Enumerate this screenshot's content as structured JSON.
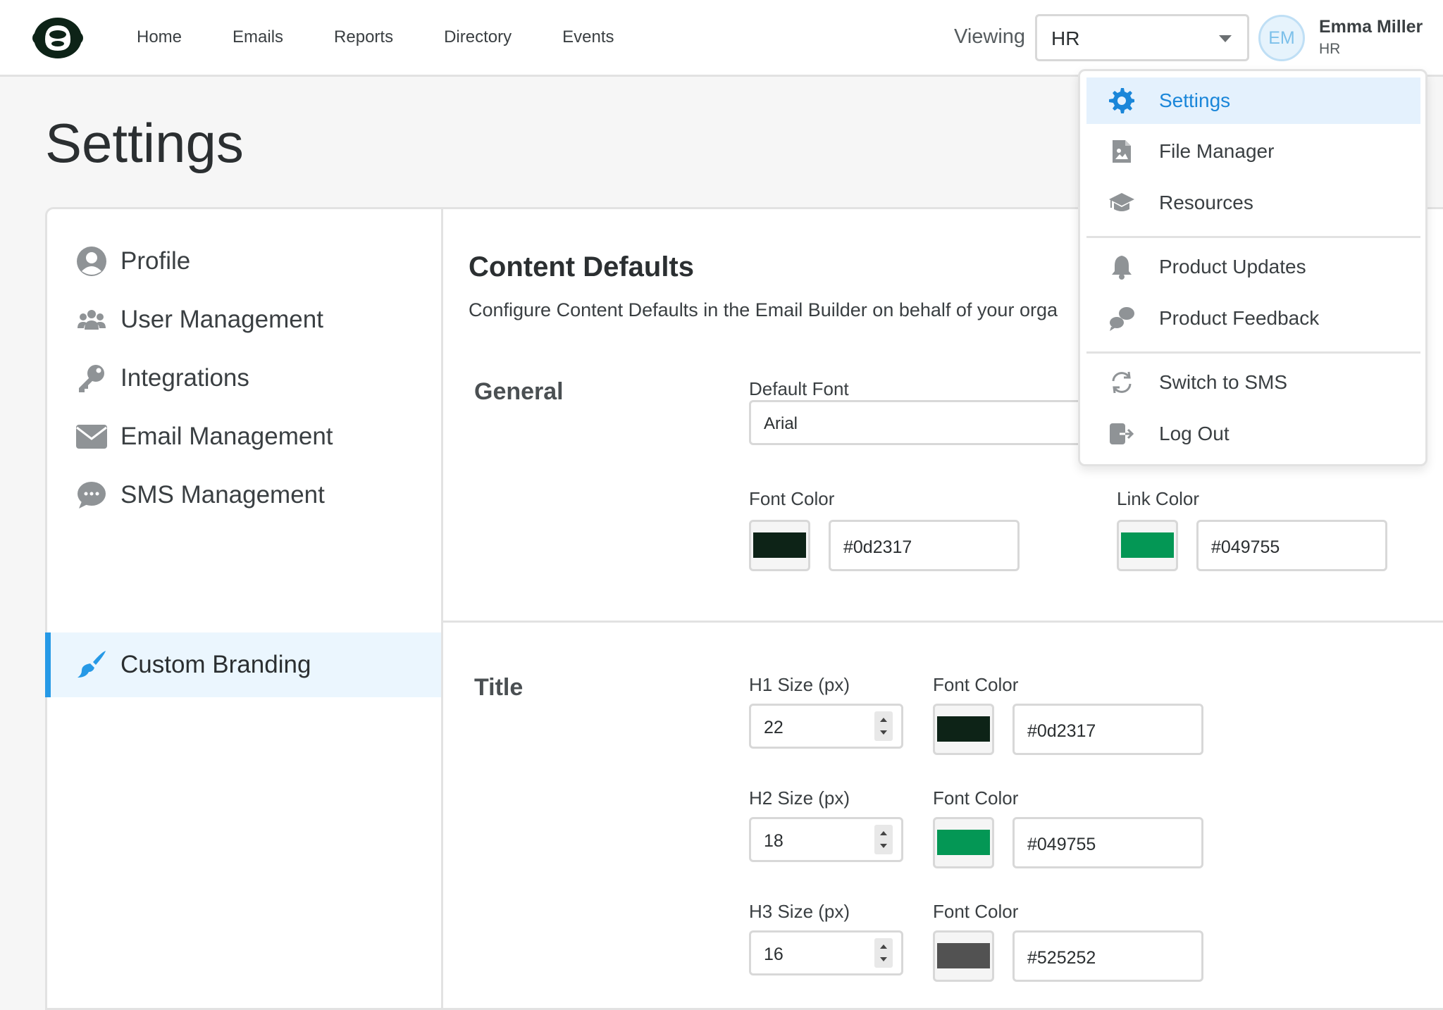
{
  "header": {
    "nav": [
      "Home",
      "Emails",
      "Reports",
      "Directory",
      "Events"
    ],
    "viewing_label": "Viewing",
    "viewing_value": "HR",
    "avatar_initials": "EM",
    "user_name": "Emma Miller",
    "user_org": "HR"
  },
  "page": {
    "title": "Settings"
  },
  "sidebar": {
    "items": [
      {
        "label": "Profile",
        "icon": "user-circle-icon"
      },
      {
        "label": "User Management",
        "icon": "users-icon"
      },
      {
        "label": "Integrations",
        "icon": "key-icon"
      },
      {
        "label": "Email Management",
        "icon": "envelope-icon"
      },
      {
        "label": "SMS Management",
        "icon": "chat-bubble-icon"
      },
      {
        "label": "Custom Branding",
        "icon": "paintbrush-icon",
        "active": true
      }
    ]
  },
  "content": {
    "title": "Content Defaults",
    "description": "Configure Content Defaults in the Email Builder on behalf of your orga",
    "general": {
      "title": "General",
      "default_font_label": "Default Font",
      "default_font_value": "Arial",
      "font_color_label": "Font Color",
      "font_color_value": "#0d2317",
      "link_color_label": "Link Color",
      "link_color_value": "#049755"
    },
    "title_section": {
      "title": "Title",
      "rows": [
        {
          "size_label": "H1 Size (px)",
          "size_value": "22",
          "color_label": "Font Color",
          "color_value": "#0d2317"
        },
        {
          "size_label": "H2 Size (px)",
          "size_value": "18",
          "color_label": "Font Color",
          "color_value": "#049755"
        },
        {
          "size_label": "H3 Size (px)",
          "size_value": "16",
          "color_label": "Font Color",
          "color_value": "#525252"
        }
      ]
    }
  },
  "menu": {
    "items": [
      {
        "label": "Settings",
        "icon": "gear-icon",
        "active": true
      },
      {
        "label": "File Manager",
        "icon": "file-image-icon"
      },
      {
        "label": "Resources",
        "icon": "graduation-cap-icon"
      },
      {
        "label": "Product Updates",
        "icon": "bell-icon"
      },
      {
        "label": "Product Feedback",
        "icon": "feedback-bubbles-icon"
      },
      {
        "label": "Switch to SMS",
        "icon": "refresh-icon"
      },
      {
        "label": "Log Out",
        "icon": "logout-icon"
      }
    ]
  },
  "colors": {
    "accent": "#2699e6",
    "accent_bg": "#ebf6fe",
    "brand_dark": "#0d2317",
    "brand_green": "#049755",
    "gray": "#525252"
  }
}
